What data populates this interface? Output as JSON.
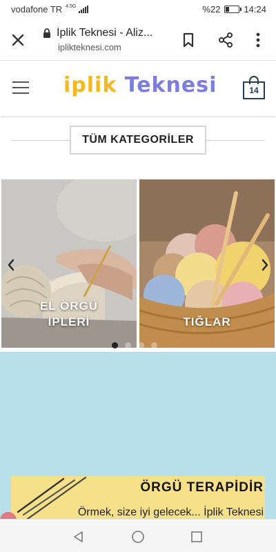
{
  "status_bar": {
    "carrier": "vodafone TR",
    "network_badge": "4.5G",
    "battery_level": "%22",
    "time": "14:24"
  },
  "browser": {
    "tab_title": "İplik Teknesi - Aliz...",
    "url": "iplikteknesi.com",
    "icons": [
      "close-icon",
      "lock-icon",
      "bookmark-icon",
      "share-icon",
      "more-vert-icon"
    ]
  },
  "header": {
    "logo_word1": "iplik",
    "logo_word2": "Teknesi",
    "cart_count": "14",
    "colors": {
      "logo_yellow": "#f5b820",
      "logo_purple": "#7b7de0",
      "cart": "#1f3e5c"
    }
  },
  "categories": {
    "heading": "TÜM KATEGORİLER",
    "cards": [
      {
        "label_line1": "EL ÖRGÜ",
        "label_line2": "İPLERİ"
      },
      {
        "label_line1": "TIĞLAR",
        "label_line2": ""
      }
    ]
  },
  "banner": {
    "title": "ÖRGÜ TERAPİDİR",
    "subtitle": "Örmek, size iyi gelecek... İplik Teknesi",
    "colors": {
      "sky": "#b7e0ec",
      "yellow": "#f6e08a"
    }
  }
}
